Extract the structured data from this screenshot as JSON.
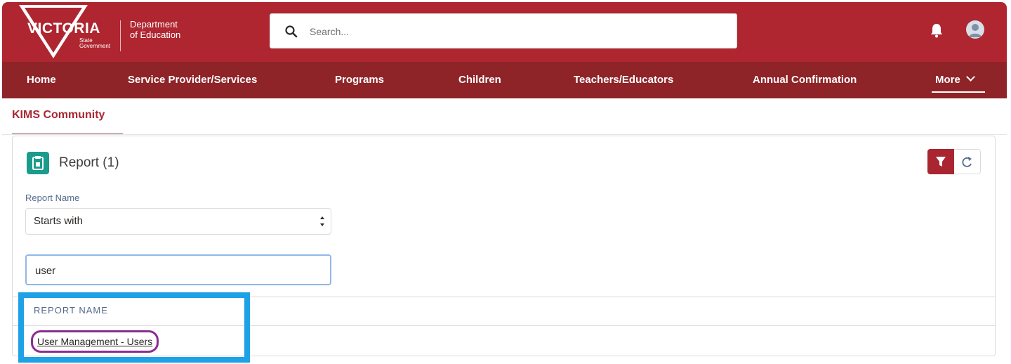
{
  "header": {
    "logo_text": "VICTORIA",
    "logo_subtext": "State Government",
    "department_line1": "Department",
    "department_line2": "of Education",
    "search_placeholder": "Search...",
    "icons": {
      "search": "search-icon",
      "notifications": "bell-icon",
      "user": "avatar-icon"
    }
  },
  "nav": {
    "items": [
      "Home",
      "Service Provider/Services",
      "Programs",
      "Children",
      "Teachers/Educators",
      "Annual Confirmation"
    ],
    "more_label": "More"
  },
  "page": {
    "tab_label": "KIMS Community"
  },
  "report": {
    "title": "Report (1)",
    "field_label": "Report Name",
    "operator_value": "Starts with",
    "search_value": "user",
    "column_header": "REPORT NAME",
    "results": [
      "User Management - Users"
    ]
  },
  "colors": {
    "brand_red": "#af2630",
    "nav_red": "#8e2428",
    "highlight_blue": "#1ea1e6",
    "focus_purple": "#8a2d91",
    "report_icon_teal": "#1b9b8c"
  }
}
